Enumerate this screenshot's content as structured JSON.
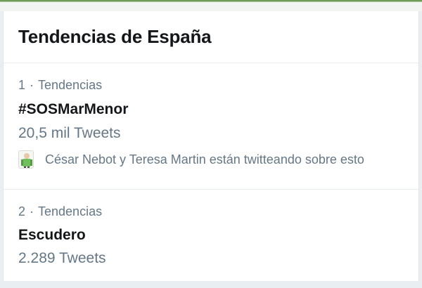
{
  "colors": {
    "title": "#14171a",
    "secondary": "#657786",
    "divider": "#e6ecf0"
  },
  "panel": {
    "title": "Tendencias de España"
  },
  "trends": [
    {
      "rank": "1",
      "separator": "·",
      "category": "Tendencias",
      "name": "#SOSMarMenor",
      "tweets": "20,5 mil Tweets",
      "context": "César Nebot y Teresa Martin están twitteando sobre esto",
      "context_icon": "user-avatar-icon"
    },
    {
      "rank": "2",
      "separator": "·",
      "category": "Tendencias",
      "name": "Escudero",
      "tweets": "2.289 Tweets"
    }
  ]
}
